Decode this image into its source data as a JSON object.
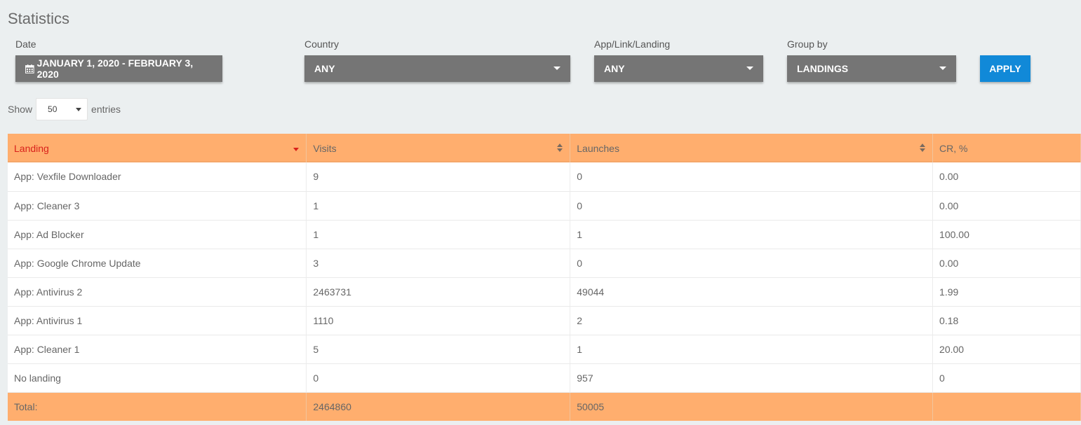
{
  "page": {
    "title": "Statistics"
  },
  "filters": {
    "date": {
      "label": "Date",
      "value": "JANUARY 1, 2020 - FEBRUARY 3, 2020",
      "icon": "calendar-icon"
    },
    "country": {
      "label": "Country",
      "value": "ANY"
    },
    "app_link_landing": {
      "label": "App/Link/Landing",
      "value": "ANY"
    },
    "group_by": {
      "label": "Group by",
      "value": "LANDINGS"
    },
    "apply_label": "APPLY"
  },
  "entries": {
    "show_label": "Show",
    "value": "50",
    "entries_label": "entries"
  },
  "table": {
    "columns": [
      "Landing",
      "Visits",
      "Launches",
      "CR, %"
    ],
    "rows": [
      [
        "App: Vexfile Downloader",
        "9",
        "0",
        "0.00"
      ],
      [
        "App: Cleaner 3",
        "1",
        "0",
        "0.00"
      ],
      [
        "App: Ad Blocker",
        "1",
        "1",
        "100.00"
      ],
      [
        "App: Google Chrome Update",
        "3",
        "0",
        "0.00"
      ],
      [
        "App: Antivirus 2",
        "2463731",
        "49044",
        "1.99"
      ],
      [
        "App: Antivirus 1",
        "1110",
        "2",
        "0.18"
      ],
      [
        "App: Cleaner 1",
        "5",
        "1",
        "20.00"
      ],
      [
        "No landing",
        "0",
        "957",
        "0"
      ]
    ],
    "footer": [
      "Total:",
      "2464860",
      "50005",
      ""
    ]
  },
  "colors": {
    "header_bg": "#ffae6e",
    "sorted_header_text": "#d9211b",
    "filter_bg": "#757575",
    "apply_bg": "#1189d8",
    "page_bg": "#ebeff0"
  }
}
